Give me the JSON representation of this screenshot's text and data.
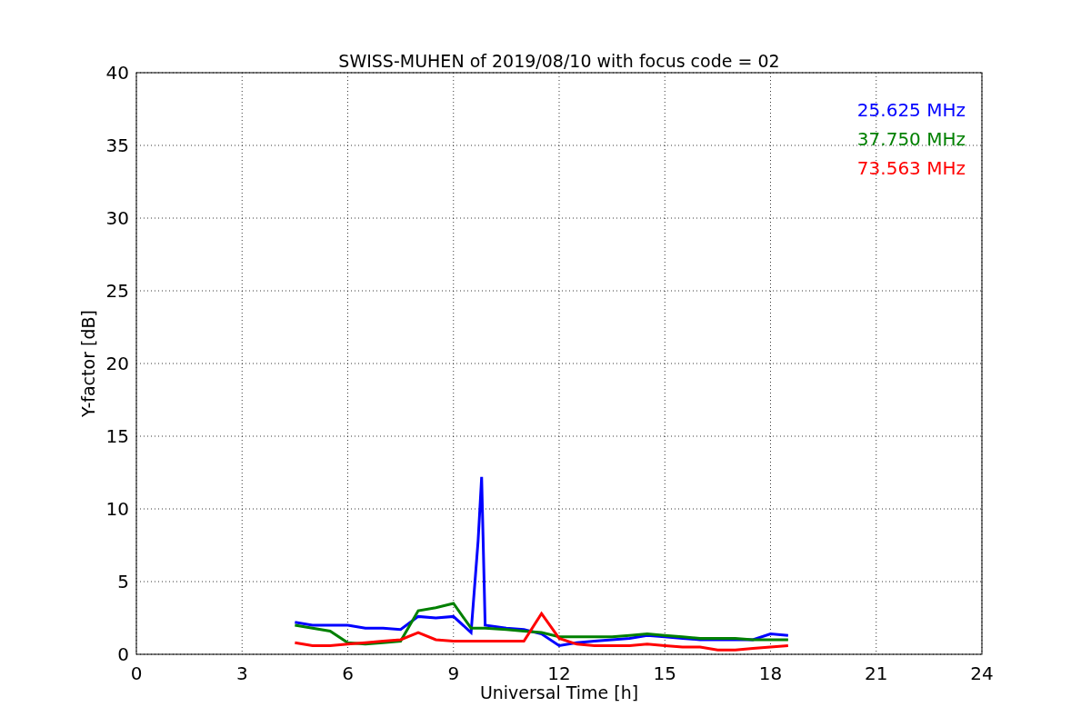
{
  "figure": {
    "chart_data": {
      "type": "line",
      "title": "SWISS-MUHEN of 2019/08/10 with focus code = 02",
      "xlabel": "Universal Time [h]",
      "ylabel": "Y-factor [dB]",
      "x": [
        4.5,
        5,
        5.5,
        6,
        6.5,
        7,
        7.5,
        8,
        8.5,
        9,
        9.5,
        9.7,
        9.8,
        9.9,
        10.5,
        11,
        11.5,
        12,
        12.5,
        13,
        13.5,
        14,
        14.5,
        15,
        15.5,
        16,
        16.5,
        17,
        17.5,
        18,
        18.5
      ],
      "series": [
        {
          "name": "25.625 MHz",
          "color": "#0000ff",
          "values": [
            2.2,
            2.0,
            2.0,
            2.0,
            1.8,
            1.8,
            1.7,
            2.6,
            2.5,
            2.6,
            1.5,
            7.8,
            12.2,
            2.0,
            1.8,
            1.7,
            1.4,
            0.6,
            0.8,
            0.9,
            1.0,
            1.1,
            1.3,
            1.2,
            1.1,
            1.0,
            1.0,
            1.0,
            1.0,
            1.4,
            1.3
          ]
        },
        {
          "name": "37.750 MHz",
          "color": "#008000",
          "values": [
            2.0,
            1.8,
            1.6,
            0.8,
            0.7,
            0.8,
            0.9,
            3.0,
            3.2,
            3.5,
            1.8,
            1.8,
            1.8,
            1.8,
            1.7,
            1.6,
            1.5,
            1.2,
            1.2,
            1.2,
            1.2,
            1.3,
            1.4,
            1.3,
            1.2,
            1.1,
            1.1,
            1.1,
            1.0,
            1.0,
            1.0
          ]
        },
        {
          "name": "73.563 MHz",
          "color": "#ff0000",
          "values": [
            0.8,
            0.6,
            0.6,
            0.7,
            0.8,
            0.9,
            1.0,
            1.5,
            1.0,
            0.9,
            0.9,
            0.9,
            0.9,
            0.9,
            0.9,
            0.9,
            2.8,
            1.1,
            0.7,
            0.6,
            0.6,
            0.6,
            0.7,
            0.6,
            0.5,
            0.5,
            0.3,
            0.3,
            0.4,
            0.5,
            0.6
          ]
        }
      ],
      "grid": true,
      "xlim": [
        0,
        24
      ],
      "ylim": [
        0,
        40
      ],
      "xticks": [
        0,
        3,
        6,
        9,
        12,
        15,
        18,
        21,
        24
      ],
      "yticks": [
        0,
        5,
        10,
        15,
        20,
        25,
        30,
        35,
        40
      ]
    }
  }
}
